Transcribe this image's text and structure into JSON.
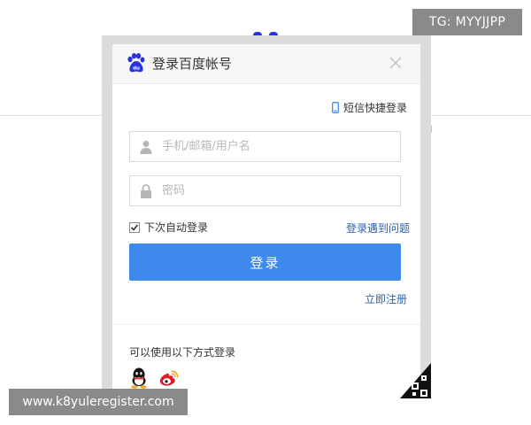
{
  "overlay": {
    "tg_badge": "TG: MYYJJPP",
    "watermark": "www.k8yuleregister.com"
  },
  "dialog": {
    "title": "登录百度帐号",
    "sms_login_label": "短信快捷登录",
    "username_placeholder": "手机/邮箱/用户名",
    "password_placeholder": "密码",
    "remember_label": "下次自动登录",
    "remember_checked": true,
    "problem_link": "登录遇到问题",
    "login_button": "登录",
    "register_link": "立即注册",
    "other_methods_label": "可以使用以下方式登录"
  },
  "icons": {
    "brand": "baidu-paw-icon",
    "close": "close-icon",
    "sms": "phone-icon",
    "user": "user-icon",
    "lock": "lock-icon",
    "qq": "qq-icon",
    "weibo": "weibo-icon",
    "qr": "qr-code-icon"
  },
  "colors": {
    "primary_button": "#3f89ec",
    "link": "#2a62b0",
    "baidu_blue": "#2932e1",
    "weibo_red": "#e6162d"
  }
}
